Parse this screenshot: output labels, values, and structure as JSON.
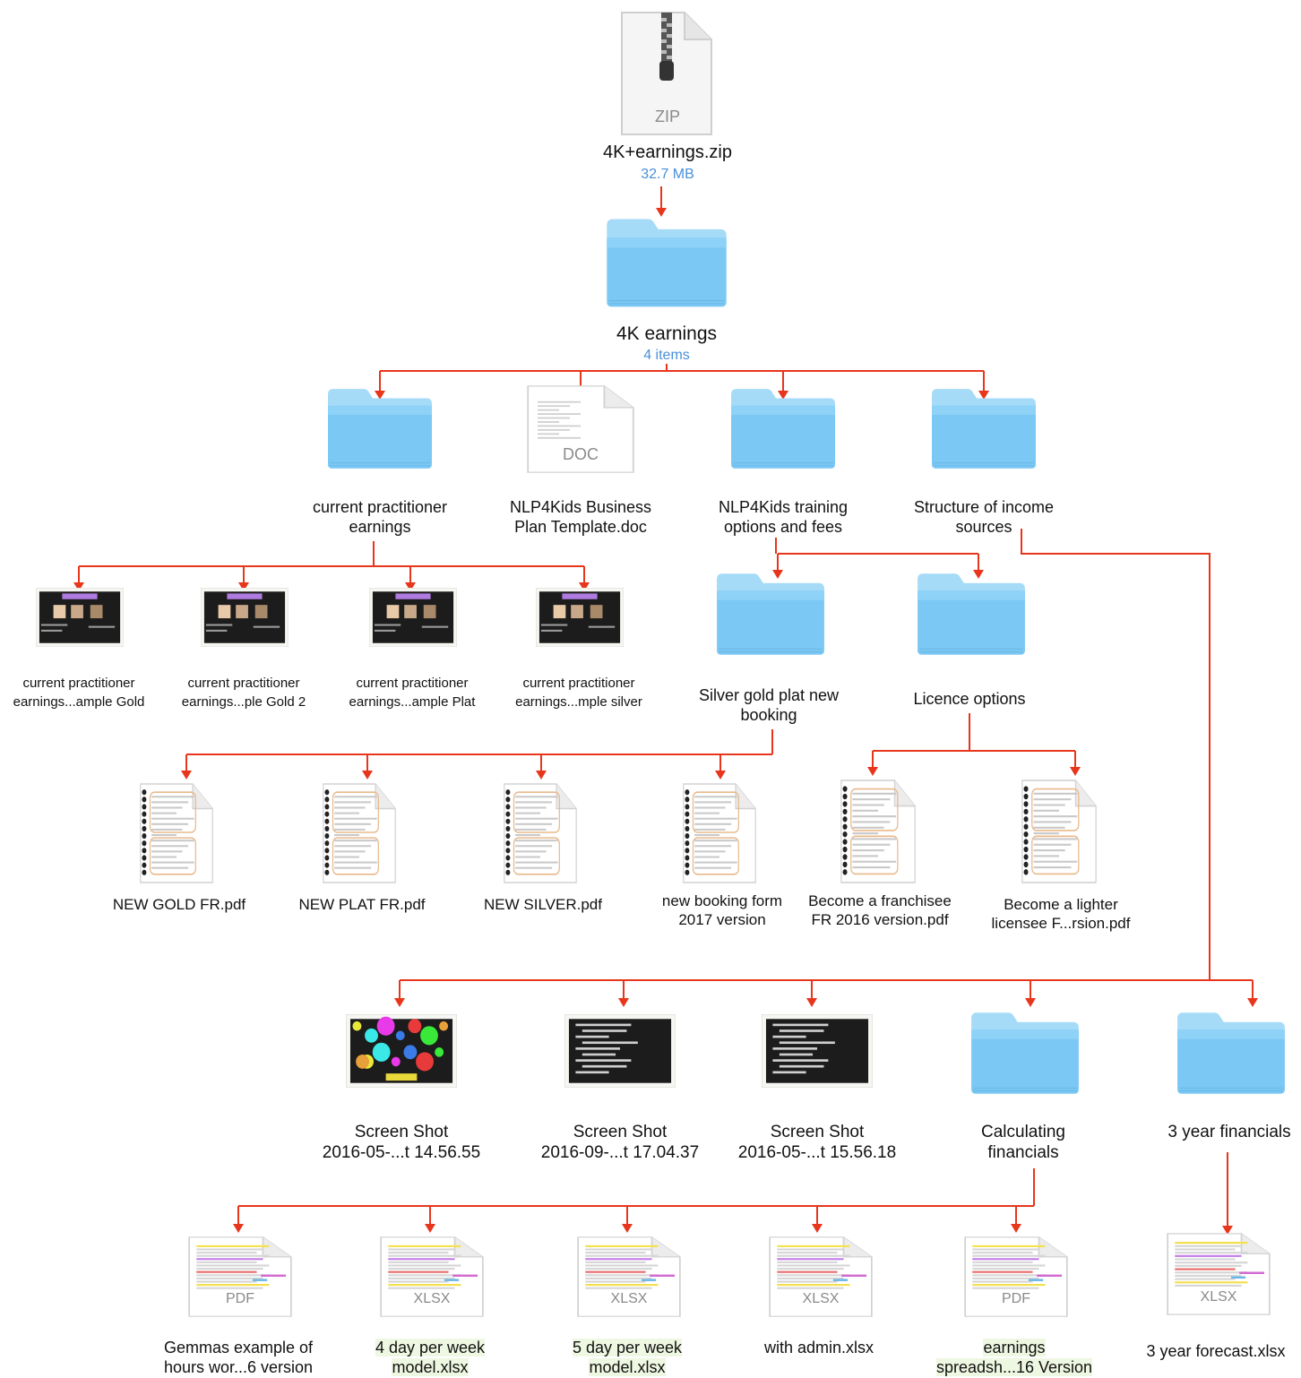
{
  "root": {
    "name": "4K+earnings.zip",
    "size": "32.7 MB",
    "type_tag": "ZIP"
  },
  "top_folder": {
    "name": "4K earnings",
    "count": "4 items"
  },
  "level1": [
    {
      "id": "cpe",
      "label": [
        "current practitioner",
        "earnings"
      ],
      "kind": "folder"
    },
    {
      "id": "bp",
      "label": [
        "NLP4Kids Business",
        "Plan Template.doc"
      ],
      "kind": "doc",
      "tag": "DOC"
    },
    {
      "id": "tof",
      "label": [
        "NLP4Kids training",
        "options and fees"
      ],
      "kind": "folder"
    },
    {
      "id": "sis",
      "label": [
        "Structure of income",
        "sources"
      ],
      "kind": "folder"
    }
  ],
  "cpe_children": [
    {
      "label": [
        "current practitioner",
        "earnings...ample Gold"
      ]
    },
    {
      "label": [
        "current practitioner",
        "earnings...ple Gold 2"
      ]
    },
    {
      "label": [
        "current practitioner",
        "earnings...ample Plat"
      ]
    },
    {
      "label": [
        "current practitioner",
        "earnings...mple silver"
      ]
    }
  ],
  "tof_children": [
    {
      "label": [
        "Silver gold plat new",
        "booking"
      ]
    },
    {
      "label": [
        "Licence options"
      ]
    }
  ],
  "booking_children": [
    {
      "label": [
        "NEW GOLD FR.pdf"
      ]
    },
    {
      "label": [
        "NEW PLAT FR.pdf"
      ]
    },
    {
      "label": [
        "NEW SILVER.pdf"
      ]
    },
    {
      "label": [
        "new booking form",
        "2017 version"
      ]
    }
  ],
  "licence_children": [
    {
      "label": [
        "Become a franchisee",
        "FR 2016 version.pdf"
      ]
    },
    {
      "label": [
        "Become a lighter",
        "licensee F...rsion.pdf"
      ]
    }
  ],
  "sis_children": [
    {
      "label": [
        "Screen Shot",
        "2016-05-...t 14.56.55"
      ]
    },
    {
      "label": [
        "Screen Shot",
        "2016-09-...t 17.04.37"
      ]
    },
    {
      "label": [
        "Screen Shot",
        "2016-05-...t 15.56.18"
      ]
    },
    {
      "label": [
        "Calculating",
        "financials"
      ]
    },
    {
      "label": [
        "3 year financials"
      ]
    }
  ],
  "calc_children": [
    {
      "label": [
        "Gemmas example of",
        "hours wor...6 version"
      ],
      "tag": "PDF"
    },
    {
      "label": [
        "4 day per week",
        "model.xlsx"
      ],
      "tag": "XLSX"
    },
    {
      "label": [
        "5 day per week",
        "model.xlsx"
      ],
      "tag": "XLSX"
    },
    {
      "label": [
        "with admin.xlsx"
      ],
      "tag": "XLSX"
    },
    {
      "label": [
        "earnings",
        "spreadsh...16 Version"
      ],
      "tag": "PDF"
    }
  ],
  "fin_children": [
    {
      "label": [
        "3 year forecast.xlsx"
      ],
      "tag": "XLSX"
    }
  ],
  "colors": {
    "arrow": "#e8361c",
    "folder_body": "#7cc8f4",
    "folder_tab": "#a6dbf8",
    "sub_text": "#4a90d9"
  }
}
